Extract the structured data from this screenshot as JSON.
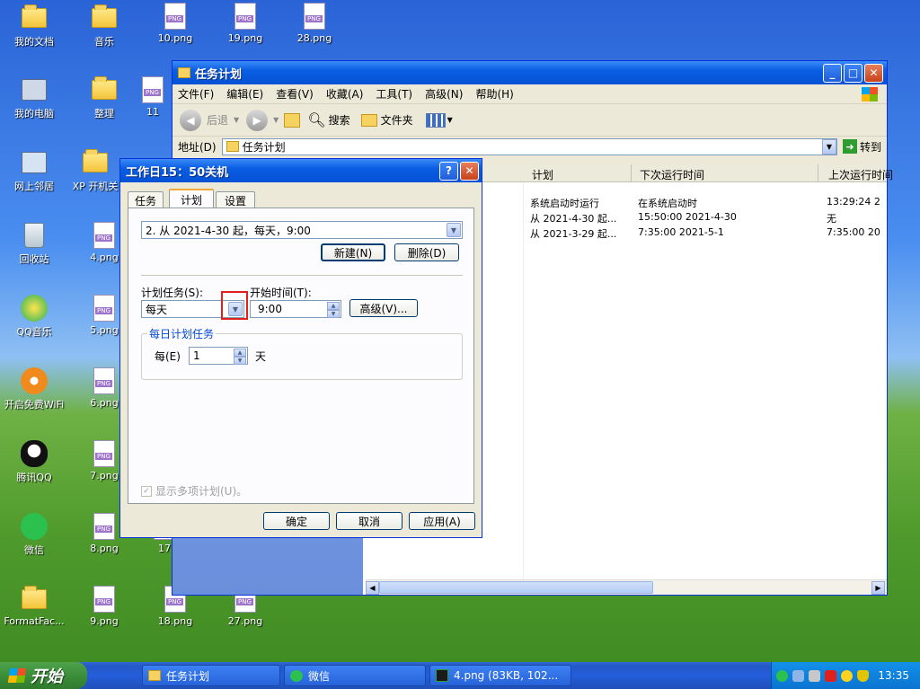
{
  "desktop": {
    "icons": [
      {
        "label": "我的文档",
        "type": "folder"
      },
      {
        "label": "音乐",
        "type": "folder"
      },
      {
        "label": "10.png",
        "type": "png"
      },
      {
        "label": "19.png",
        "type": "png"
      },
      {
        "label": "28.png",
        "type": "png"
      },
      {
        "label": "我的电脑",
        "type": "pc"
      },
      {
        "label": "整理",
        "type": "folder"
      },
      {
        "label": "11",
        "type": "png"
      },
      {
        "label": "网上邻居",
        "type": "net"
      },
      {
        "label": "XP 开机关",
        "type": "folder"
      },
      {
        "label": "回收站",
        "type": "bin"
      },
      {
        "label": "4.png",
        "type": "png"
      },
      {
        "label": "QQ音乐",
        "type": "qqmusic"
      },
      {
        "label": "5.png",
        "type": "png"
      },
      {
        "label": "开启免费WiFi",
        "type": "wifi"
      },
      {
        "label": "6.png",
        "type": "png"
      },
      {
        "label": "腾讯QQ",
        "type": "qq"
      },
      {
        "label": "7.png",
        "type": "png"
      },
      {
        "label": "微信",
        "type": "wechat"
      },
      {
        "label": "8.png",
        "type": "png"
      },
      {
        "label": "17",
        "type": "png"
      },
      {
        "label": "FormatFac...",
        "type": "folder"
      },
      {
        "label": "9.png",
        "type": "png"
      },
      {
        "label": "18.png",
        "type": "png"
      },
      {
        "label": "27.png",
        "type": "png"
      }
    ]
  },
  "explorer": {
    "title": "任务计划",
    "menu": [
      "文件(F)",
      "编辑(E)",
      "查看(V)",
      "收藏(A)",
      "工具(T)",
      "高级(N)",
      "帮助(H)"
    ],
    "toolbar": {
      "back": "后退",
      "search": "搜索",
      "folders": "文件夹"
    },
    "address_label": "地址(D)",
    "address_value": "任务计划",
    "go_label": "转到",
    "columns": [
      "计划",
      "下次运行时间",
      "上次运行时间"
    ],
    "rows": [
      {
        "schedule": "系统启动时运行",
        "next": "在系统启动时",
        "last": "13:29:24  2"
      },
      {
        "schedule": "从 2021-4-30 起...",
        "next": "15:50:00  2021-4-30",
        "last": "无"
      },
      {
        "schedule": "从 2021-3-29 起...",
        "next": "7:35:00  2021-5-1",
        "last": "7:35:00  20"
      }
    ]
  },
  "dialog": {
    "title": "工作日15：50关机",
    "tabs": [
      "任务",
      "计划",
      "设置"
    ],
    "active_tab": "计划",
    "schedule_select": "2. 从 2021-4-30 起，每天，9:00",
    "new_button": "新建(N)",
    "delete_button": "删除(D)",
    "schedule_task_label": "计划任务(S):",
    "schedule_task_value": "每天",
    "start_time_label": "开始时间(T):",
    "start_time_value": "9:00",
    "advanced_button": "高级(V)...",
    "daily_group_label": "每日计划任务",
    "every_label": "每(E)",
    "every_value": "1",
    "day_unit": "天",
    "show_multiple": "显示多项计划(U)。",
    "ok": "确定",
    "cancel": "取消",
    "apply": "应用(A)"
  },
  "taskbar": {
    "start": "开始",
    "tasks": [
      "任务计划",
      "微信",
      "4.png (83KB, 102..."
    ],
    "clock": "13:35"
  },
  "colors": {
    "xp_blue": "#0a5de2",
    "highlight_red": "#e0201a",
    "start_green": "#3c8e3a"
  }
}
